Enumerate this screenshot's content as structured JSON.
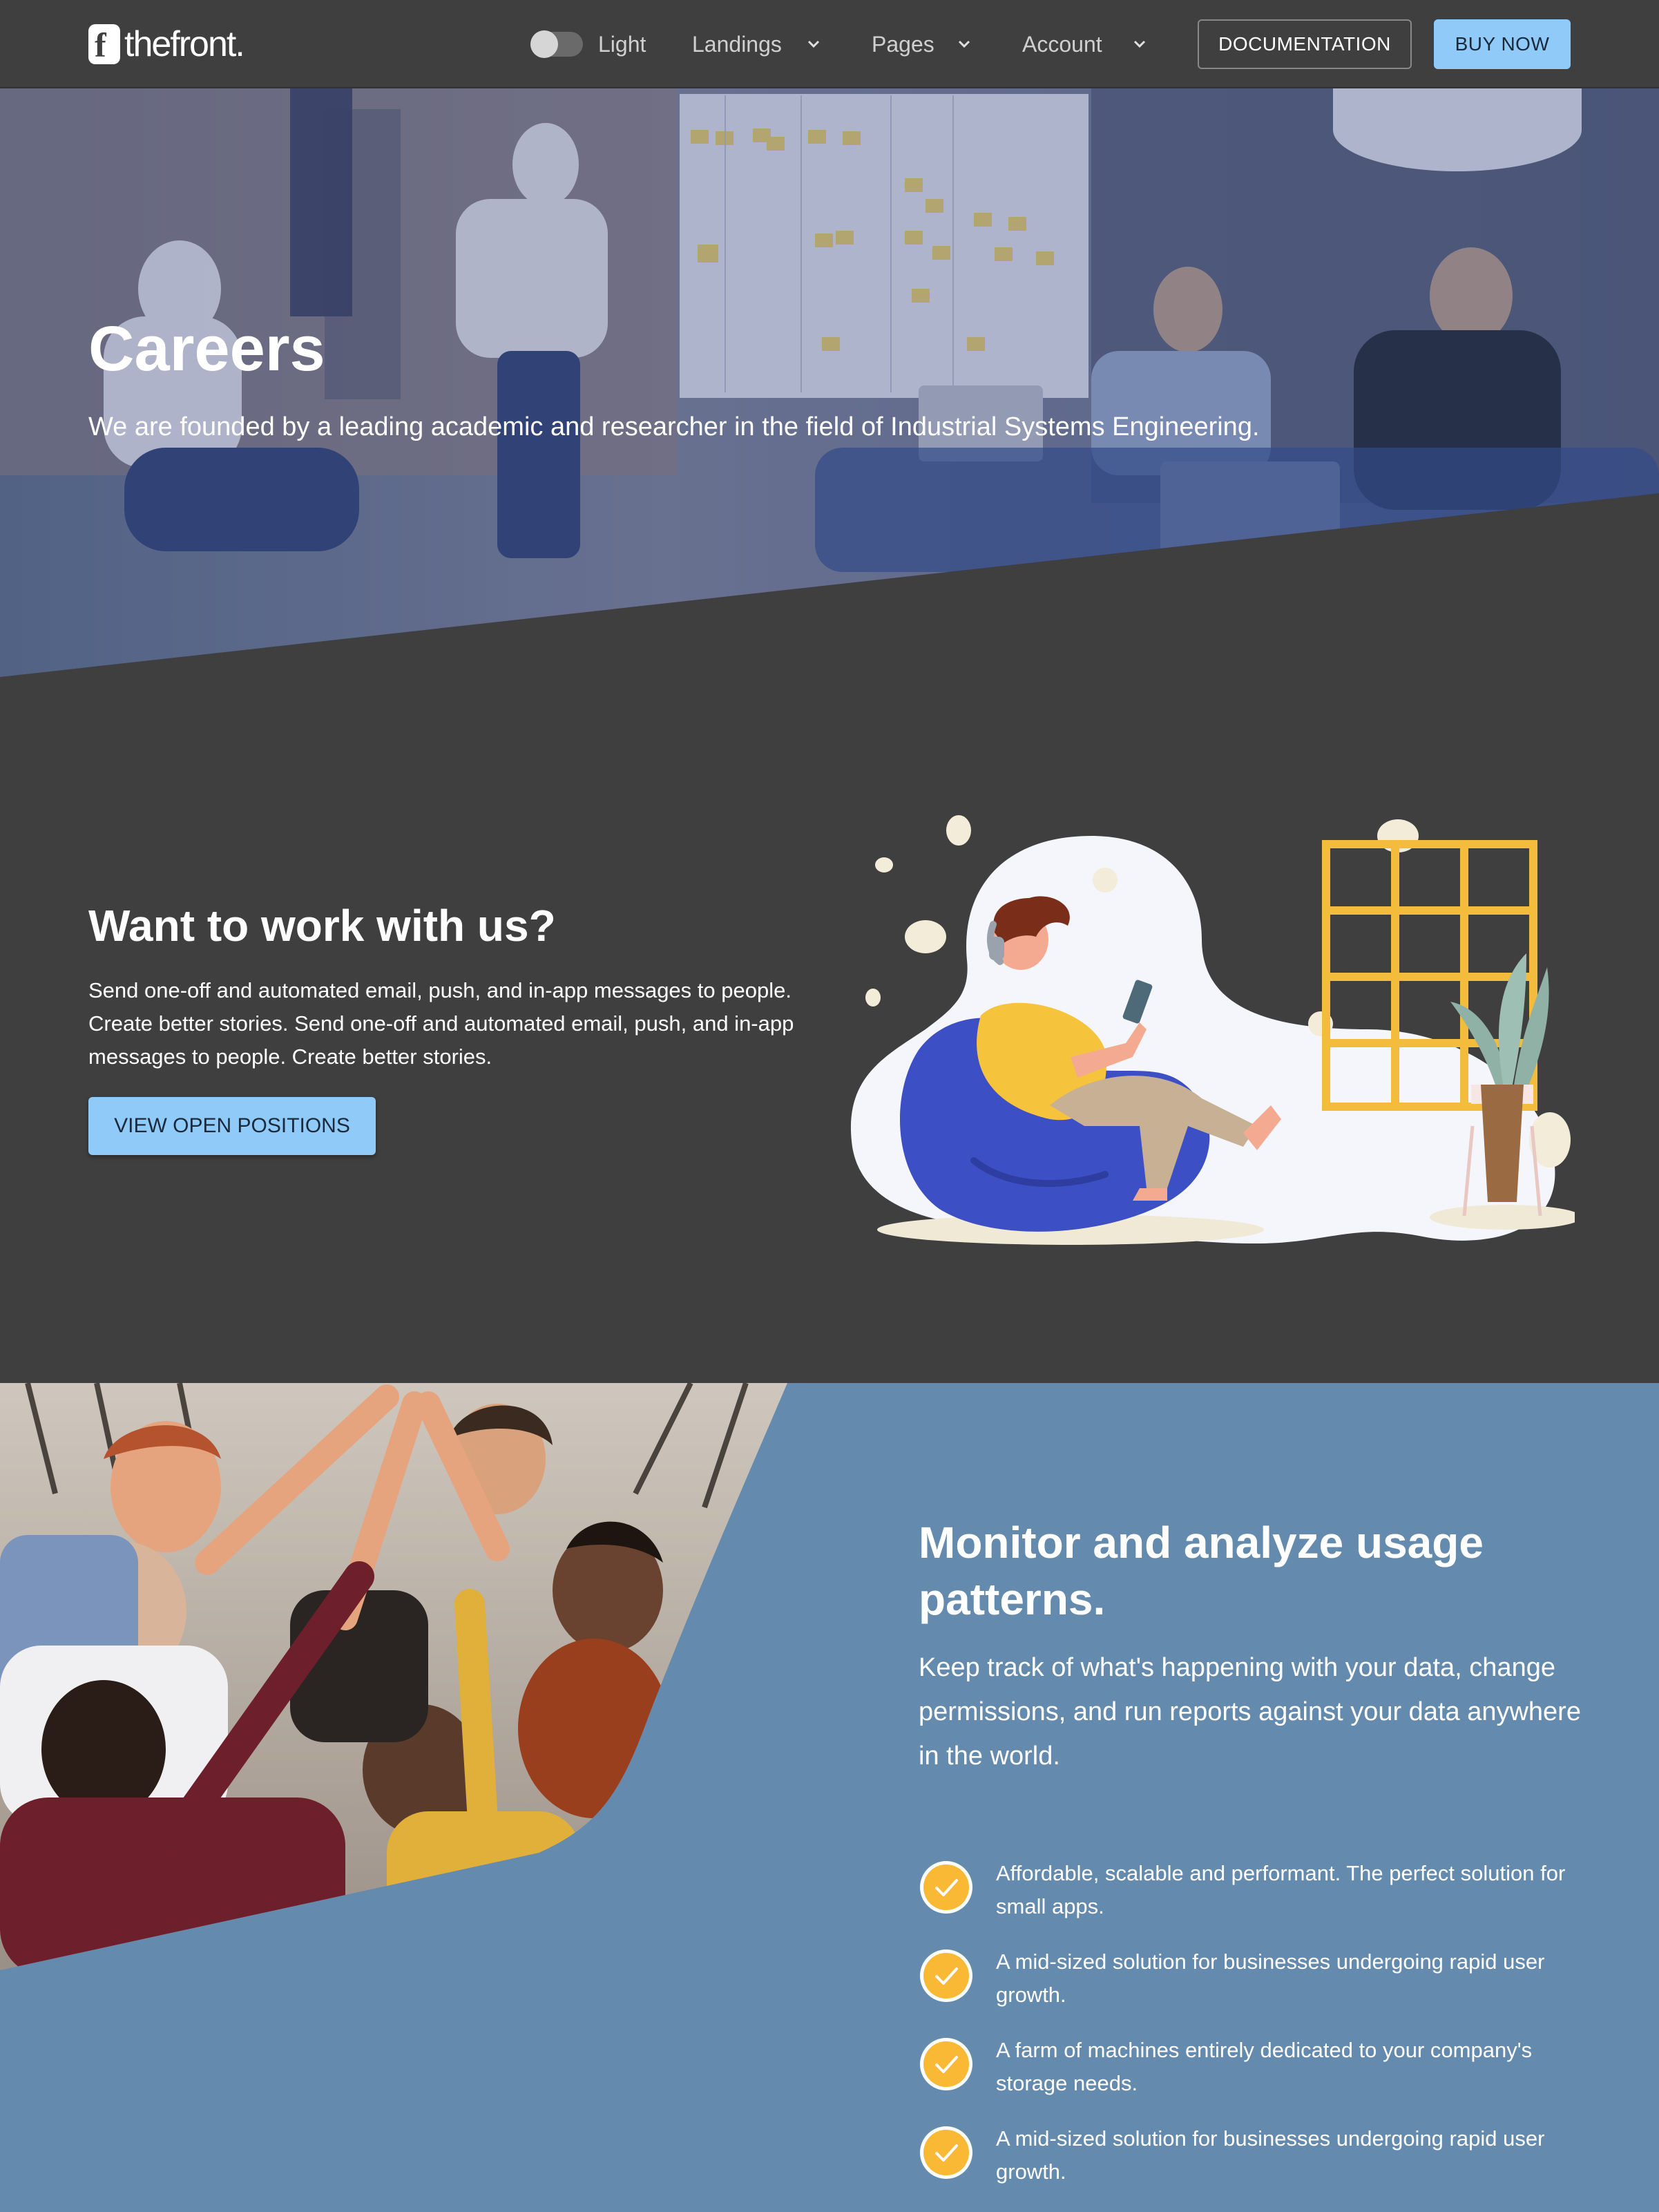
{
  "nav": {
    "logo_letter": "f",
    "logo_text": "thefront.",
    "theme_label": "Light",
    "menu": [
      {
        "label": "Landings"
      },
      {
        "label": "Pages"
      },
      {
        "label": "Account"
      }
    ],
    "docs_label": "DOCUMENTATION",
    "buy_label": "BUY NOW"
  },
  "hero": {
    "title": "Careers",
    "subtitle": "We are founded by a leading academic and researcher in the field of Industrial Systems Engineering."
  },
  "work": {
    "title": "Want to work with us?",
    "text": "Send one-off and automated email, push, and in-app messages to people. Create better stories. Send one-off and automated email, push, and in-app messages to people. Create better stories.",
    "button_label": "VIEW OPEN POSITIONS"
  },
  "monitor": {
    "title": "Monitor and analyze usage patterns.",
    "text": "Keep track of what's happening with your data, change permissions, and run reports against your data anywhere in the world.",
    "features": [
      {
        "text": "Affordable, scalable and performant. The perfect solution for small apps."
      },
      {
        "text": "A mid-sized solution for businesses undergoing rapid user growth."
      },
      {
        "text": "A farm of machines entirely dedicated to your company's storage needs."
      },
      {
        "text": "A mid-sized solution for businesses undergoing rapid user growth."
      }
    ]
  },
  "colors": {
    "background": "#3f3f3f",
    "accent": "#90caf9",
    "monitor_bg": "#648bae",
    "check_yellow": "#f9b934"
  }
}
